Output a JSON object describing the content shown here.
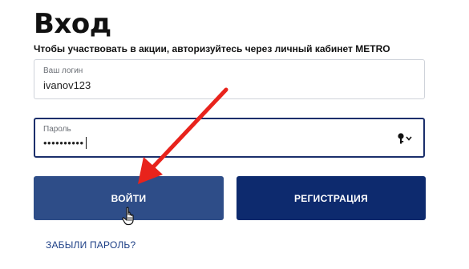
{
  "page": {
    "title": "Вход",
    "subtitle": "Чтобы участвовать в акции, авторизуйтесь через личный кабинет METRO"
  },
  "form": {
    "login": {
      "label": "Ваш логин",
      "value": "ivanov123"
    },
    "password": {
      "label": "Пароль",
      "value": "••••••••••"
    }
  },
  "buttons": {
    "login_label": "ВОЙТИ",
    "register_label": "РЕГИСТРАЦИЯ"
  },
  "links": {
    "forgot_label": "ЗАБЫЛИ ПАРОЛЬ?"
  },
  "colors": {
    "login_button": "#2e4d88",
    "register_button": "#0d2a6e",
    "annotation_arrow": "#e8231c"
  },
  "icons": {
    "password_toggle": "key-icon",
    "annotation": "red-arrow",
    "pointer": "hand-cursor-icon"
  }
}
